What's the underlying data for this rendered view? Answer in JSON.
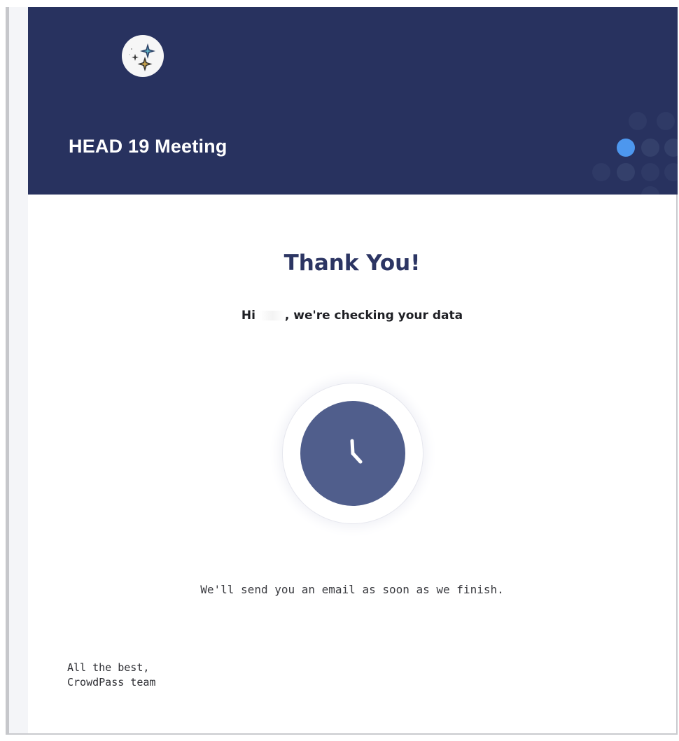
{
  "header": {
    "logo_icon": "star-compass-logo-icon",
    "event_title": "HEAD 19 Meeting",
    "background_color": "#28325f",
    "active_dot_color": "#4d97ee"
  },
  "main": {
    "heading": "Thank You!",
    "greeting_prefix": "Hi",
    "greeting_suffix": ", we're checking your data",
    "status_icon": "clock-icon",
    "status_color": "#505e8c",
    "notice": "We'll send you an email as soon as we finish."
  },
  "signoff": {
    "line1": "All the best,",
    "line2": "CrowdPass team"
  }
}
